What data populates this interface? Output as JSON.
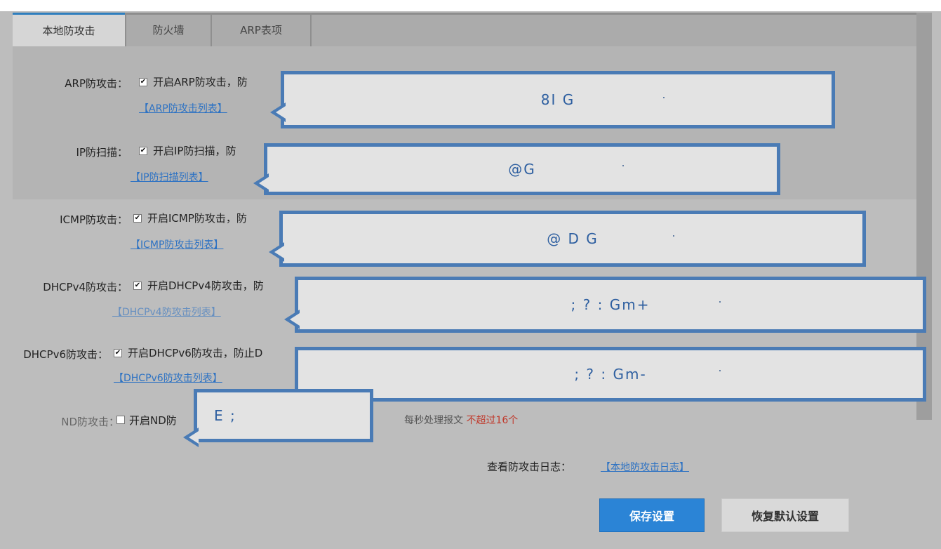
{
  "tabs": [
    {
      "label": "本地防攻击",
      "active": true
    },
    {
      "label": "防火墙",
      "active": false
    },
    {
      "label": "ARP表项",
      "active": false
    }
  ],
  "rows": [
    {
      "label": "ARP防攻击：",
      "checked": true,
      "desc": "开启ARP防攻击，防",
      "link": "【ARP防攻击列表】"
    },
    {
      "label": "IP防扫描：",
      "checked": true,
      "desc": "开启IP防扫描，防",
      "link": "【IP防扫描列表】"
    },
    {
      "label": "ICMP防攻击：",
      "checked": true,
      "desc": "开启ICMP防攻击，防",
      "link": "【ICMP防攻击列表】"
    },
    {
      "label": "DHCPv4防攻击：",
      "checked": true,
      "desc": "开启DHCPv4防攻击，防",
      "link": "【DHCPv4防攻击列表】"
    },
    {
      "label": "DHCPv6防攻击：",
      "checked": true,
      "desc": "开启DHCPv6防攻击，防止D",
      "link": "【DHCPv6防攻击列表】"
    },
    {
      "label": "ND防攻击：",
      "checked": false,
      "desc": "开启ND防",
      "tail_text": "每秒处理报文",
      "tail_warn": "不超过16个"
    }
  ],
  "callouts": [
    {
      "text": "8I G"
    },
    {
      "text": "@G"
    },
    {
      "text": "@ D G"
    },
    {
      "text": "; ? : Gm+"
    },
    {
      "text": "; ? : Gm-"
    },
    {
      "text": "E ;"
    }
  ],
  "log": {
    "label": "查看防攻击日志：",
    "link": "【本地防攻击日志】"
  },
  "buttons": {
    "save": "保存设置",
    "restore": "恢复默认设置"
  },
  "colors": {
    "accent": "#2b84d6",
    "callout_border": "#4a7bb5",
    "link": "#2d72c3",
    "warn": "#c0392b"
  }
}
